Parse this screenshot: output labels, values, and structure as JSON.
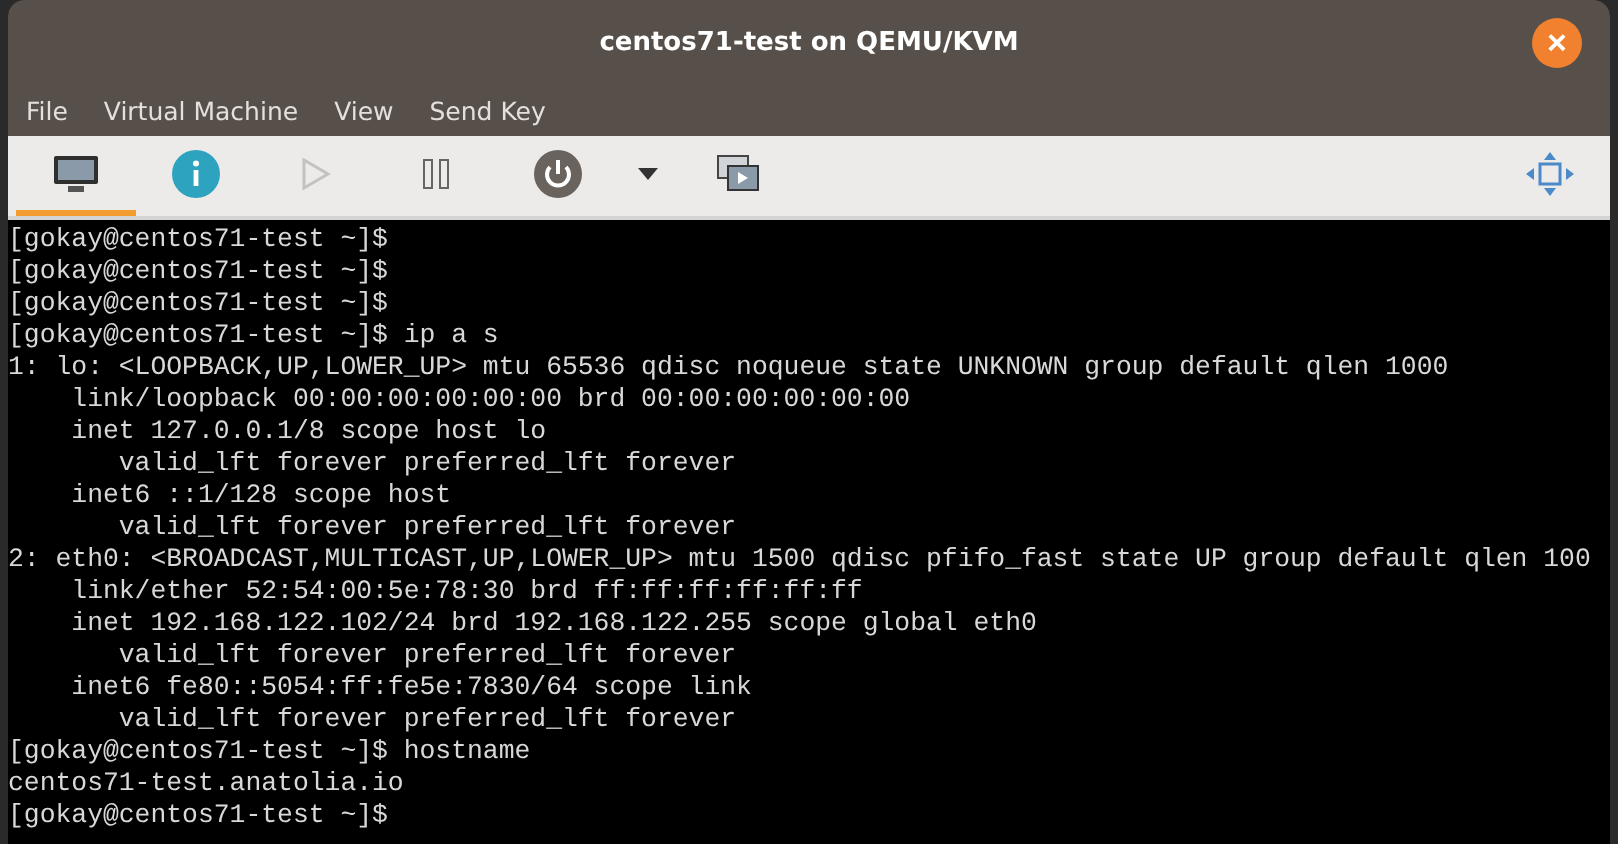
{
  "window": {
    "title": "centos71-test on QEMU/KVM",
    "close": "×"
  },
  "menu": [
    "File",
    "Virtual Machine",
    "View",
    "Send Key"
  ],
  "toolbar": [
    {
      "kind": "console",
      "selected": true,
      "disabled": false
    },
    {
      "kind": "details",
      "selected": false,
      "disabled": false
    },
    {
      "kind": "run",
      "selected": false,
      "disabled": true
    },
    {
      "kind": "pause",
      "selected": false,
      "disabled": false
    },
    {
      "kind": "power",
      "selected": false,
      "disabled": false
    },
    {
      "kind": "dropdown",
      "selected": false,
      "disabled": false
    },
    {
      "kind": "snapshots",
      "selected": false,
      "disabled": false
    },
    {
      "kind": "fullscreen",
      "selected": false,
      "disabled": false
    }
  ],
  "terminal": {
    "lines": [
      "[gokay@centos71-test ~]$",
      "[gokay@centos71-test ~]$",
      "[gokay@centos71-test ~]$",
      "[gokay@centos71-test ~]$ ip a s",
      "1: lo: <LOOPBACK,UP,LOWER_UP> mtu 65536 qdisc noqueue state UNKNOWN group default qlen 1000",
      "    link/loopback 00:00:00:00:00:00 brd 00:00:00:00:00:00",
      "    inet 127.0.0.1/8 scope host lo",
      "       valid_lft forever preferred_lft forever",
      "    inet6 ::1/128 scope host",
      "       valid_lft forever preferred_lft forever",
      "2: eth0: <BROADCAST,MULTICAST,UP,LOWER_UP> mtu 1500 qdisc pfifo_fast state UP group default qlen 100",
      "    link/ether 52:54:00:5e:78:30 brd ff:ff:ff:ff:ff:ff",
      "    inet 192.168.122.102/24 brd 192.168.122.255 scope global eth0",
      "       valid_lft forever preferred_lft forever",
      "    inet6 fe80::5054:ff:fe5e:7830/64 scope link",
      "       valid_lft forever preferred_lft forever",
      "[gokay@centos71-test ~]$ hostname",
      "centos71-test.anatolia.io",
      "[gokay@centos71-test ~]$"
    ]
  }
}
